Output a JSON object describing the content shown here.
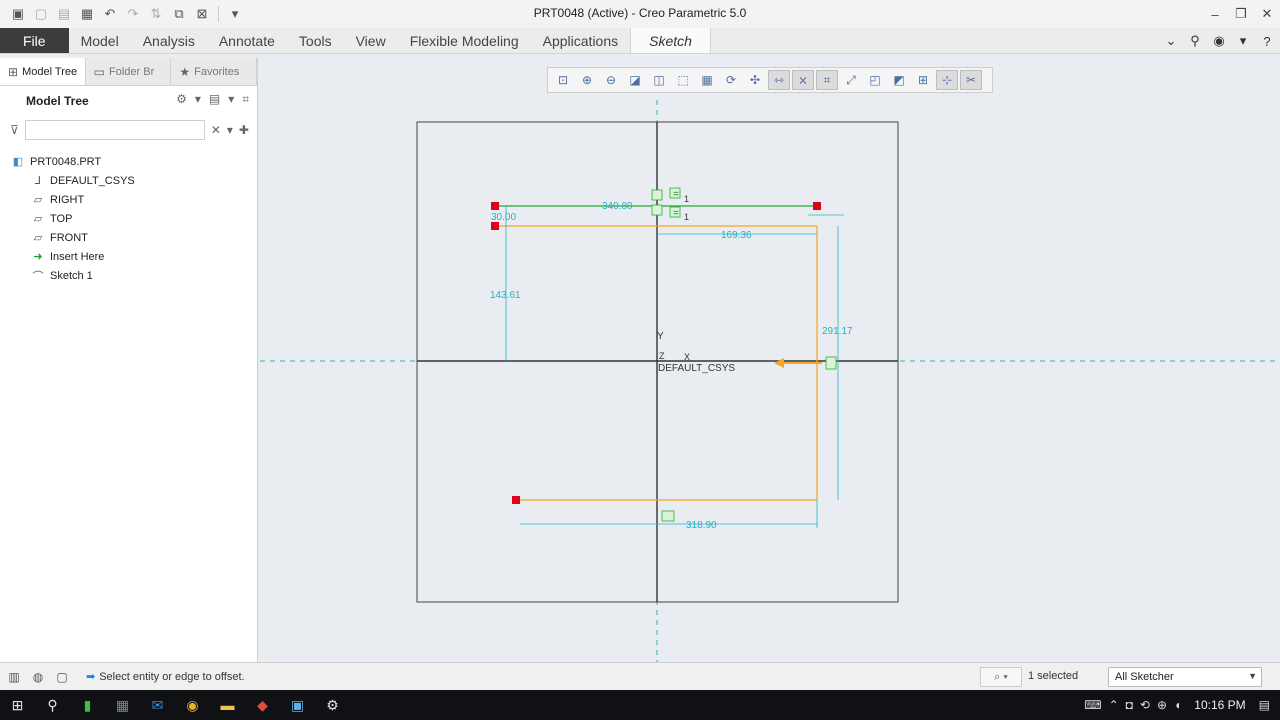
{
  "window": {
    "title": "PRT0048 (Active) - Creo Parametric 5.0"
  },
  "ribbon": {
    "tabs": [
      {
        "label": "File"
      },
      {
        "label": "Model"
      },
      {
        "label": "Analysis"
      },
      {
        "label": "Annotate"
      },
      {
        "label": "Tools"
      },
      {
        "label": "View"
      },
      {
        "label": "Flexible Modeling"
      },
      {
        "label": "Applications"
      },
      {
        "label": "Sketch"
      }
    ],
    "active_tab": "Sketch"
  },
  "panel": {
    "tabs": [
      {
        "label": "Model Tree",
        "icon": "model-tree-icon"
      },
      {
        "label": "Folder Br",
        "icon": "folder-icon"
      },
      {
        "label": "Favorites",
        "icon": "star-icon"
      }
    ],
    "header": "Model Tree",
    "search": {
      "value": "",
      "placeholder": ""
    },
    "tree": {
      "root": "PRT0048.PRT",
      "items": [
        {
          "label": "DEFAULT_CSYS",
          "icon": "csys-icon"
        },
        {
          "label": "RIGHT",
          "icon": "datum-plane-icon"
        },
        {
          "label": "TOP",
          "icon": "datum-plane-icon"
        },
        {
          "label": "FRONT",
          "icon": "datum-plane-icon"
        },
        {
          "label": "Insert Here",
          "icon": "insert-arrow-icon"
        },
        {
          "label": "Sketch 1",
          "icon": "sketch-icon"
        }
      ]
    }
  },
  "sketch": {
    "dimensions": {
      "top_width": "340.80",
      "top_height": "30.00",
      "right_half": "169.36",
      "left_height": "143.61",
      "right_height": "291.17",
      "bottom_width": "318.90"
    },
    "csys_label": "DEFAULT_CSYS",
    "axis_x": "X",
    "axis_y": "Y",
    "axis_z": "Z",
    "constraint_equal": "=",
    "constraint_index": "1",
    "colors": {
      "sketch_line": "#f5a623",
      "dimension": "#1fb3c8",
      "endpoint": "#e0001b",
      "constraint": "#2aa830",
      "centerline": "#2fb5a5"
    }
  },
  "status": {
    "message": "Select entity or edge to offset.",
    "selected_count": "1 selected",
    "filter": "All Sketcher"
  },
  "taskbar": {
    "time": "10:16 PM"
  }
}
